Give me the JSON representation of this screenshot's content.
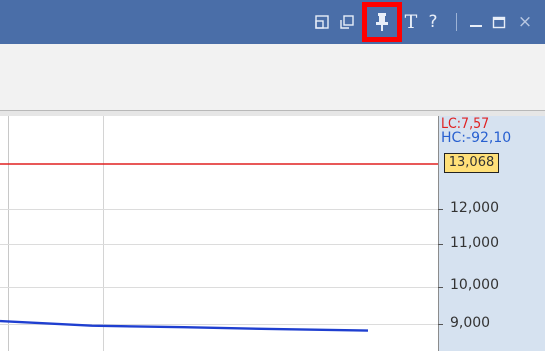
{
  "titlebar": {
    "icons": [
      {
        "name": "window-restore-icon"
      },
      {
        "name": "window-copy-icon"
      },
      {
        "name": "pin-icon"
      },
      {
        "name": "text-icon",
        "glyph": "T"
      },
      {
        "name": "help-icon",
        "glyph": "?"
      },
      {
        "name": "minimize-icon"
      },
      {
        "name": "maximize-icon"
      },
      {
        "name": "close-icon",
        "glyph": "×"
      }
    ],
    "highlighted_icon": "pin-icon",
    "background_color": "#4a6ea8",
    "highlight_color": "#ff0000"
  },
  "chart": {
    "lc_label": "LC:7,57",
    "hc_label": "HC:-92,10",
    "current_value": "13,068",
    "y_ticks": [
      "12,000",
      "11,000",
      "10,000",
      "9,000"
    ],
    "reference_line_color": "#e02020",
    "series_color": "#1f3fd0",
    "axis_panel_color": "#d6e2f0",
    "tag_color": "#ffe079"
  },
  "chart_data": {
    "type": "line",
    "y_tick_values": [
      12000,
      11000,
      10000,
      9000
    ],
    "current_value": 13068,
    "reference_line_value": 13068,
    "series": [
      {
        "values": [
          9090,
          8970,
          8930,
          8880,
          8840
        ]
      }
    ]
  }
}
